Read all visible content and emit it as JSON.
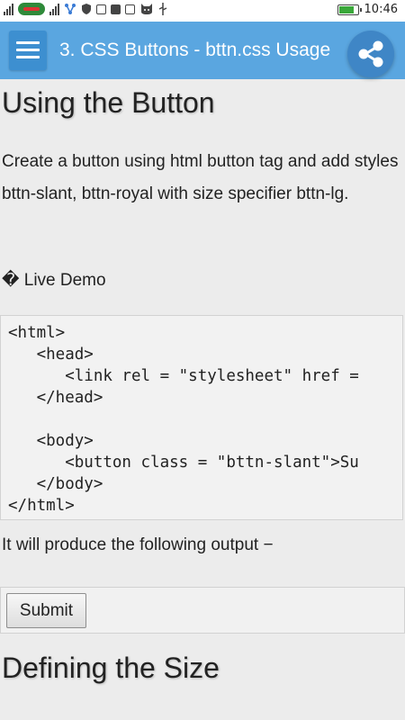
{
  "status_bar": {
    "time": "10:46",
    "icons": [
      "signal-icon",
      "carrier-icon",
      "signal-icon",
      "share-network-icon",
      "shield-icon",
      "instagram-icon",
      "facebook-icon",
      "zalo-icon",
      "cat-icon",
      "usb-icon",
      "battery-icon"
    ]
  },
  "app_bar": {
    "title": "3. CSS Buttons - bttn.css Usage",
    "menu_icon": "hamburger-menu-icon",
    "share_icon": "share-icon",
    "color": "#5aa6e0"
  },
  "content": {
    "heading1": "Using the Button",
    "paragraph": "Create a button using html button tag and add styles bttn-slant, bttn-royal with size specifier bttn-lg.",
    "live_demo": "� Live Demo",
    "code": "<html>\n   <head>\n      <link rel = \"stylesheet\" href = \n   </head>\n\n   <body>\n      <button class = \"bttn-slant\">Su\n   </body>\n</html>",
    "output_text": "It will produce the following output −",
    "submit_label": "Submit",
    "heading2": "Defining the Size"
  }
}
